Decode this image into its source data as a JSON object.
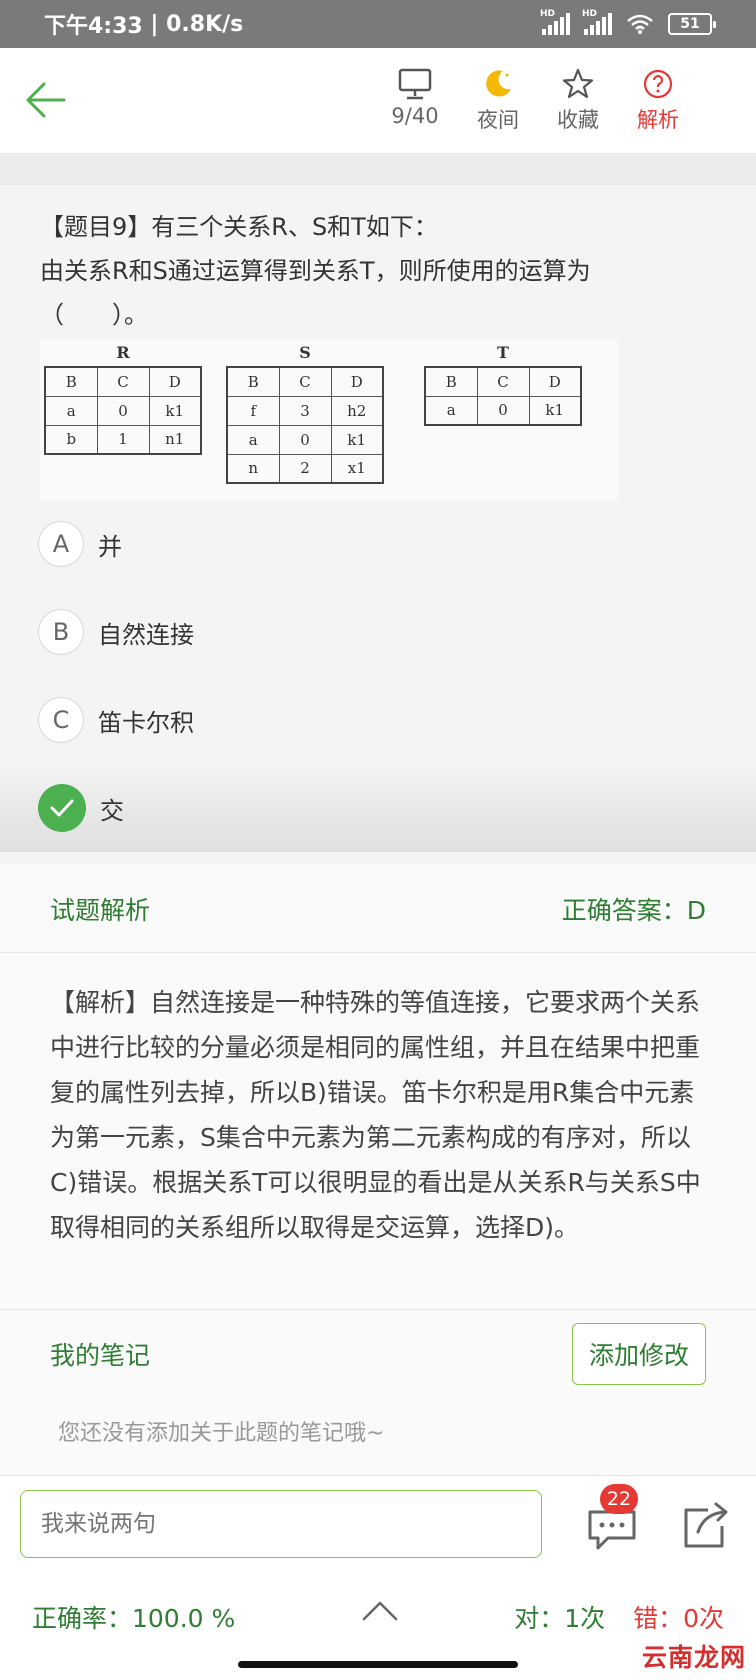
{
  "status_bar": {
    "time": "下午4:33",
    "speed": "0.8K/s",
    "battery": "51",
    "network_label": "HD"
  },
  "toolbar": {
    "progress": "9/40",
    "night_label": "夜间",
    "favorite_label": "收藏",
    "analysis_label": "解析"
  },
  "question": {
    "line1": "【题目9】有三个关系R、S和T如下：",
    "line2": "由关系R和S通过运算得到关系T，则所使用的运算为",
    "line3": "（　　）。",
    "relations": {
      "R": {
        "name": "R",
        "header": [
          "B",
          "C",
          "D"
        ],
        "rows": [
          [
            "a",
            "0",
            "k1"
          ],
          [
            "b",
            "1",
            "n1"
          ]
        ]
      },
      "S": {
        "name": "S",
        "header": [
          "B",
          "C",
          "D"
        ],
        "rows": [
          [
            "f",
            "3",
            "h2"
          ],
          [
            "a",
            "0",
            "k1"
          ],
          [
            "n",
            "2",
            "x1"
          ]
        ]
      },
      "T": {
        "name": "T",
        "header": [
          "B",
          "C",
          "D"
        ],
        "rows": [
          [
            "a",
            "0",
            "k1"
          ]
        ]
      }
    }
  },
  "options": [
    {
      "letter": "A",
      "text": "并",
      "state": "normal"
    },
    {
      "letter": "B",
      "text": "自然连接",
      "state": "normal"
    },
    {
      "letter": "C",
      "text": "笛卡尔积",
      "state": "normal"
    },
    {
      "letter": "D",
      "text": "交",
      "state": "correct"
    }
  ],
  "analysis": {
    "title": "试题解析",
    "answer": "正确答案：D",
    "text": "【解析】自然连接是一种特殊的等值连接，它要求两个关系中进行比较的分量必须是相同的属性组，并且在结果中把重复的属性列去掉，所以B)错误。笛卡尔积是用R集合中元素为第一元素，S集合中元素为第二元素构成的有序对，所以C)错误。根据关系T可以很明显的看出是从关系R与关系S中取得相同的关系组所以取得是交运算，选择D)。"
  },
  "notes": {
    "title": "我的笔记",
    "edit_button": "添加修改",
    "empty_text": "您还没有添加关于此题的笔记哦~"
  },
  "comment": {
    "placeholder": "我来说两句",
    "count": "22"
  },
  "footer": {
    "accuracy": "正确率：100.0 %",
    "correct": "对：1次",
    "wrong": "错：0次"
  },
  "watermark": "云南龙网",
  "colors": {
    "accent_green": "#2e7d32",
    "check_green": "#4caf50",
    "red": "#e53935"
  }
}
